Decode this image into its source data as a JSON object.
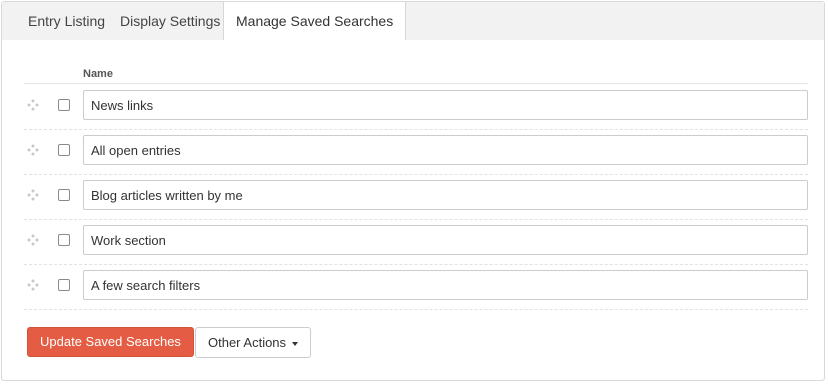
{
  "tabs": [
    {
      "label": "Entry Listing",
      "active": false
    },
    {
      "label": "Display Settings",
      "active": false
    },
    {
      "label": "Manage Saved Searches",
      "active": true
    }
  ],
  "table": {
    "column_header": "Name",
    "rows": [
      {
        "name": "News links",
        "checked": false
      },
      {
        "name": "All open entries",
        "checked": false
      },
      {
        "name": "Blog articles written by me",
        "checked": false
      },
      {
        "name": "Work section",
        "checked": false
      },
      {
        "name": "A few search filters",
        "checked": false
      }
    ]
  },
  "actions": {
    "update_label": "Update Saved Searches",
    "other_label": "Other Actions"
  },
  "icons": {
    "drag_handle": "drag-handle-icon",
    "dropdown": "caret-down-icon"
  },
  "colors": {
    "primary_button": "#e45c43",
    "tab_bar_bg": "#f2f2f2"
  }
}
